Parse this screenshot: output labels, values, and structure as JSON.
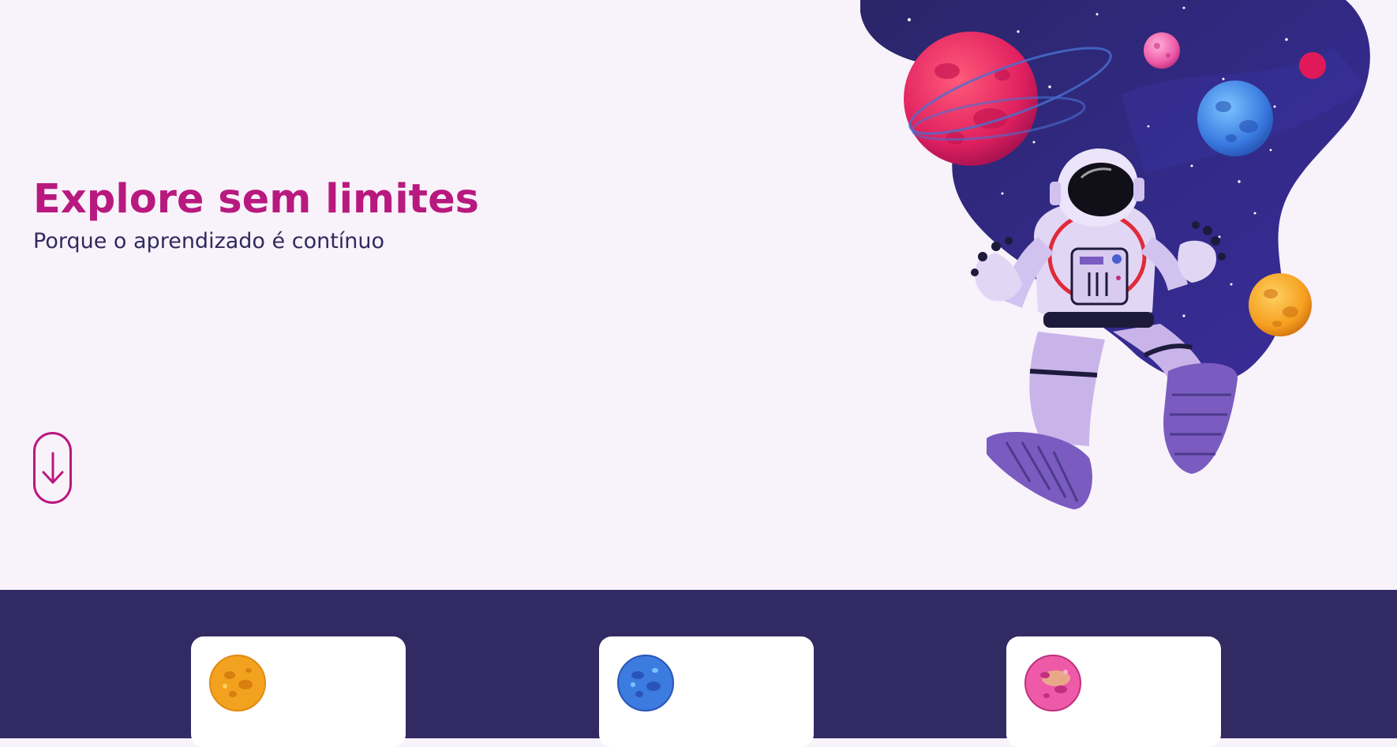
{
  "hero": {
    "title": "Explore sem limites",
    "subtitle": "Porque o aprendizado é contínuo",
    "scroll_icon": "arrow-down-icon",
    "illustration": "astronaut-in-space-illustration"
  },
  "features": {
    "cards": [
      {
        "icon": "orange-planet-icon"
      },
      {
        "icon": "blue-planet-icon"
      },
      {
        "icon": "pink-planet-icon"
      }
    ]
  },
  "colors": {
    "background": "#f8f2fa",
    "accent": "#b8197f",
    "text_dark": "#2f2a5e",
    "band": "#322b63",
    "card": "#ffffff"
  }
}
